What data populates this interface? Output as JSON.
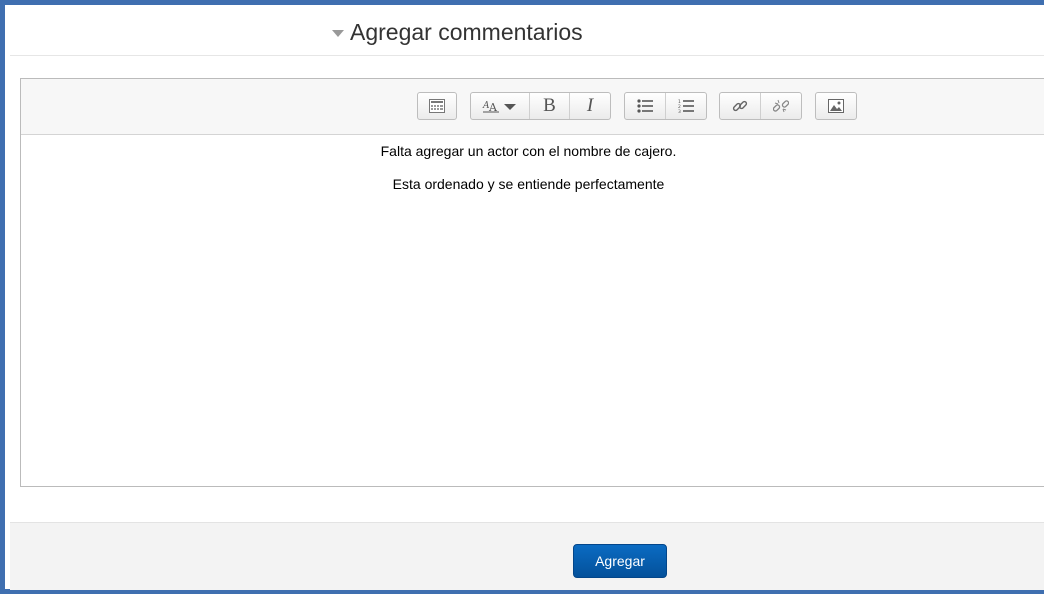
{
  "section": {
    "title": "Agregar commentarios",
    "collapse_icon": "caret-down-icon"
  },
  "toolbar": {
    "buttons": [
      {
        "name": "toolbar-toggle",
        "icon": "toolbar-toggle-icon"
      },
      {
        "name": "font-style",
        "icon": "font-style-icon"
      },
      {
        "name": "bold",
        "icon": "bold-icon",
        "label": "B"
      },
      {
        "name": "italic",
        "icon": "italic-icon",
        "label": "I"
      },
      {
        "name": "unordered-list",
        "icon": "bullet-list-icon"
      },
      {
        "name": "ordered-list",
        "icon": "numbered-list-icon"
      },
      {
        "name": "link",
        "icon": "link-icon"
      },
      {
        "name": "unlink",
        "icon": "unlink-icon"
      },
      {
        "name": "image",
        "icon": "image-icon"
      }
    ]
  },
  "editor": {
    "lines": [
      "Falta agregar un actor con el nombre de cajero.",
      "Esta ordenado y se entiende perfectamente"
    ]
  },
  "footer": {
    "submit_label": "Agregar"
  },
  "colors": {
    "frame_border": "#3f6fb0",
    "primary_button": "#0a6bc2"
  }
}
